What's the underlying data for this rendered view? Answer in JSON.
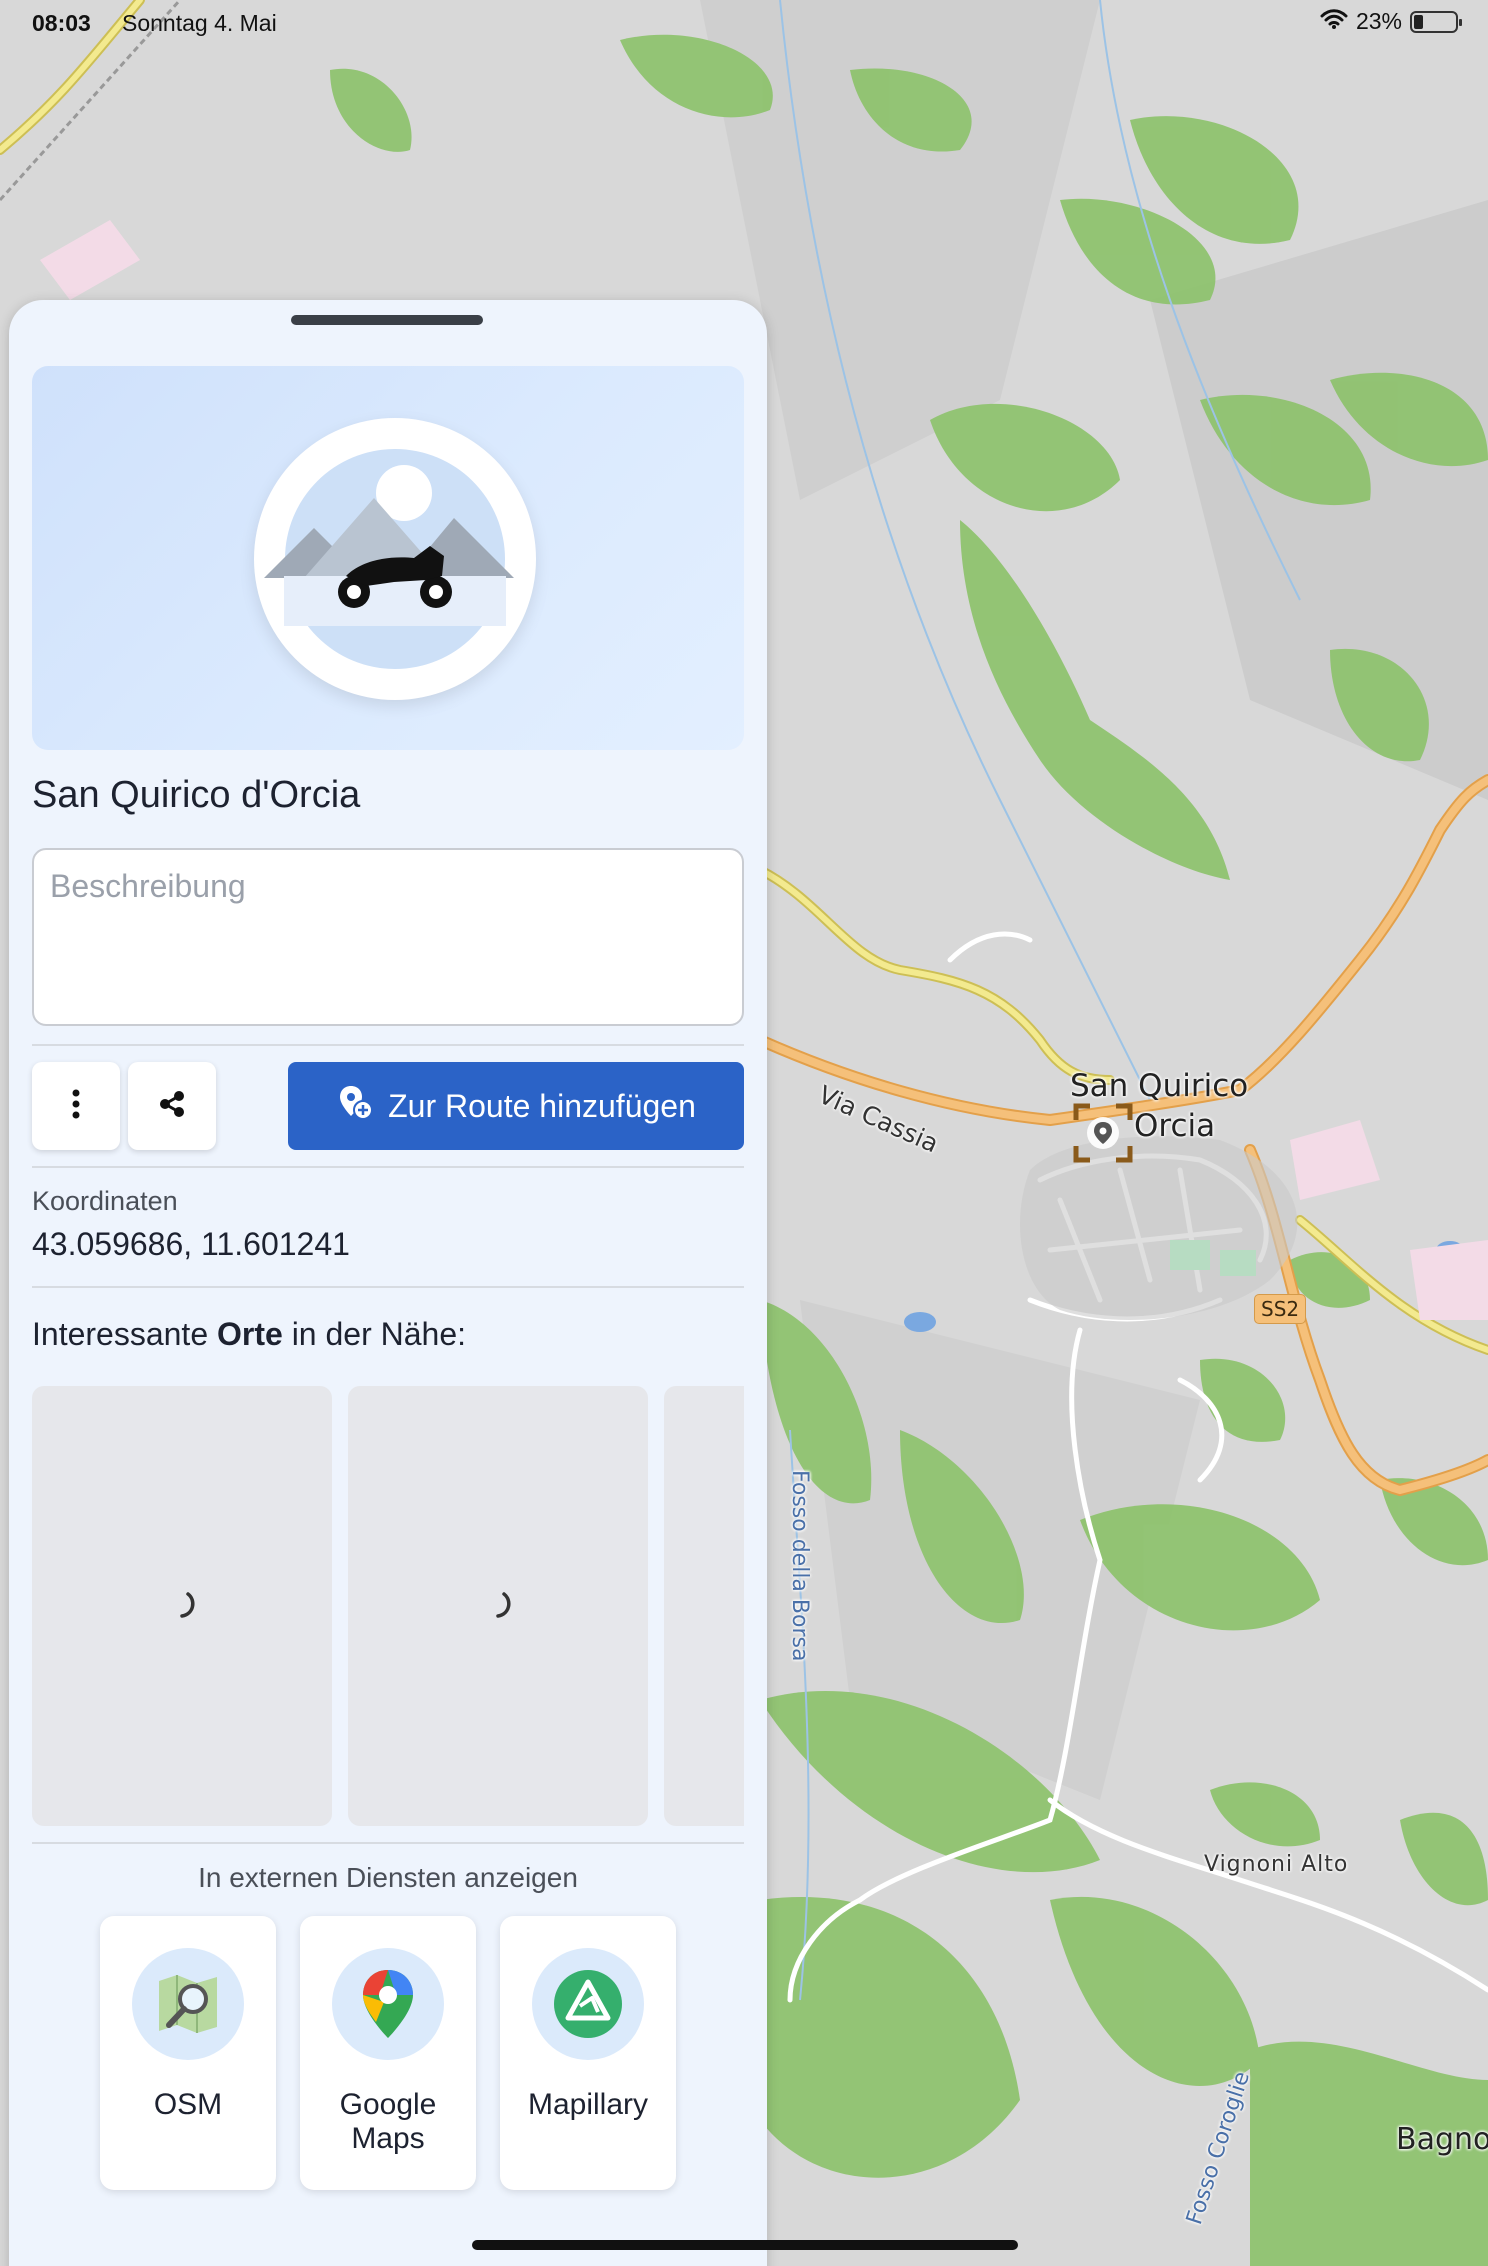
{
  "status_bar": {
    "time": "08:03",
    "date": "Sonntag 4. Mai",
    "battery": "23%"
  },
  "sheet": {
    "place_name": "San Quirico d'Orcia",
    "description_placeholder": "Beschreibung",
    "add_route_label": "Zur Route hinzufügen",
    "coordinates_label": "Koordinaten",
    "coordinates_value": "43.059686, 11.601241",
    "nearby_prefix": "Interessante ",
    "nearby_bold": "Orte",
    "nearby_suffix": " in der Nähe:",
    "external_title": "In externen Diensten anzeigen",
    "external_services": [
      {
        "label": "OSM",
        "icon": "osm-icon"
      },
      {
        "label": "Google Maps",
        "icon": "google-maps-icon"
      },
      {
        "label": "Mapillary",
        "icon": "mapillary-icon"
      }
    ]
  },
  "map": {
    "town_label_line1": "San Quirico",
    "town_label_line2": "Orcia",
    "road_via_cassia": "Via Cassia",
    "road_ss2": "SS2",
    "stream_borsa": "Fosso della Borsa",
    "stream_corogle": "Fosso Coroglie",
    "village_vignoni": "Vignoni Alto",
    "village_bagno": "Bagno"
  },
  "colors": {
    "primary": "#2b63c7",
    "sheet_bg": "#eef4fd",
    "map_bg": "#d9d9d9",
    "forest": "#8cc26a",
    "road_major": "#f2b766",
    "road_minor": "#f0e68a"
  }
}
